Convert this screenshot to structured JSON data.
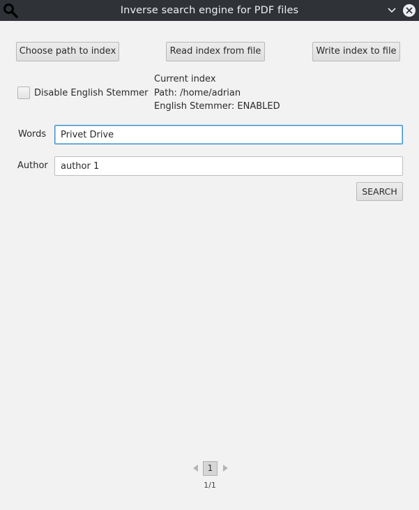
{
  "window": {
    "title": "Inverse search engine for PDF files",
    "icon": "search-icon",
    "controls": [
      "chevron-down-icon",
      "close-icon"
    ]
  },
  "toolbar": {
    "choose_path_label": "Choose path to index",
    "read_index_label": "Read index from file",
    "write_index_label": "Write index to file"
  },
  "stemmer": {
    "checkbox_label": "Disable English Stemmer",
    "checked": false
  },
  "index_info": {
    "heading": "Current index",
    "path_line": "Path: /home/adrian",
    "stemmer_line": "English Stemmer: ENABLED"
  },
  "words": {
    "label": "Words",
    "value": "Privet Drive"
  },
  "author": {
    "label": "Author",
    "value": "author 1"
  },
  "search": {
    "button_label": "SEARCH"
  },
  "pagination": {
    "current_page": "1",
    "page_count": "1/1"
  },
  "colors": {
    "titlebar_bg": "#2f3338",
    "window_bg": "#f2f2f2",
    "focus_border": "#3d8ec9"
  }
}
